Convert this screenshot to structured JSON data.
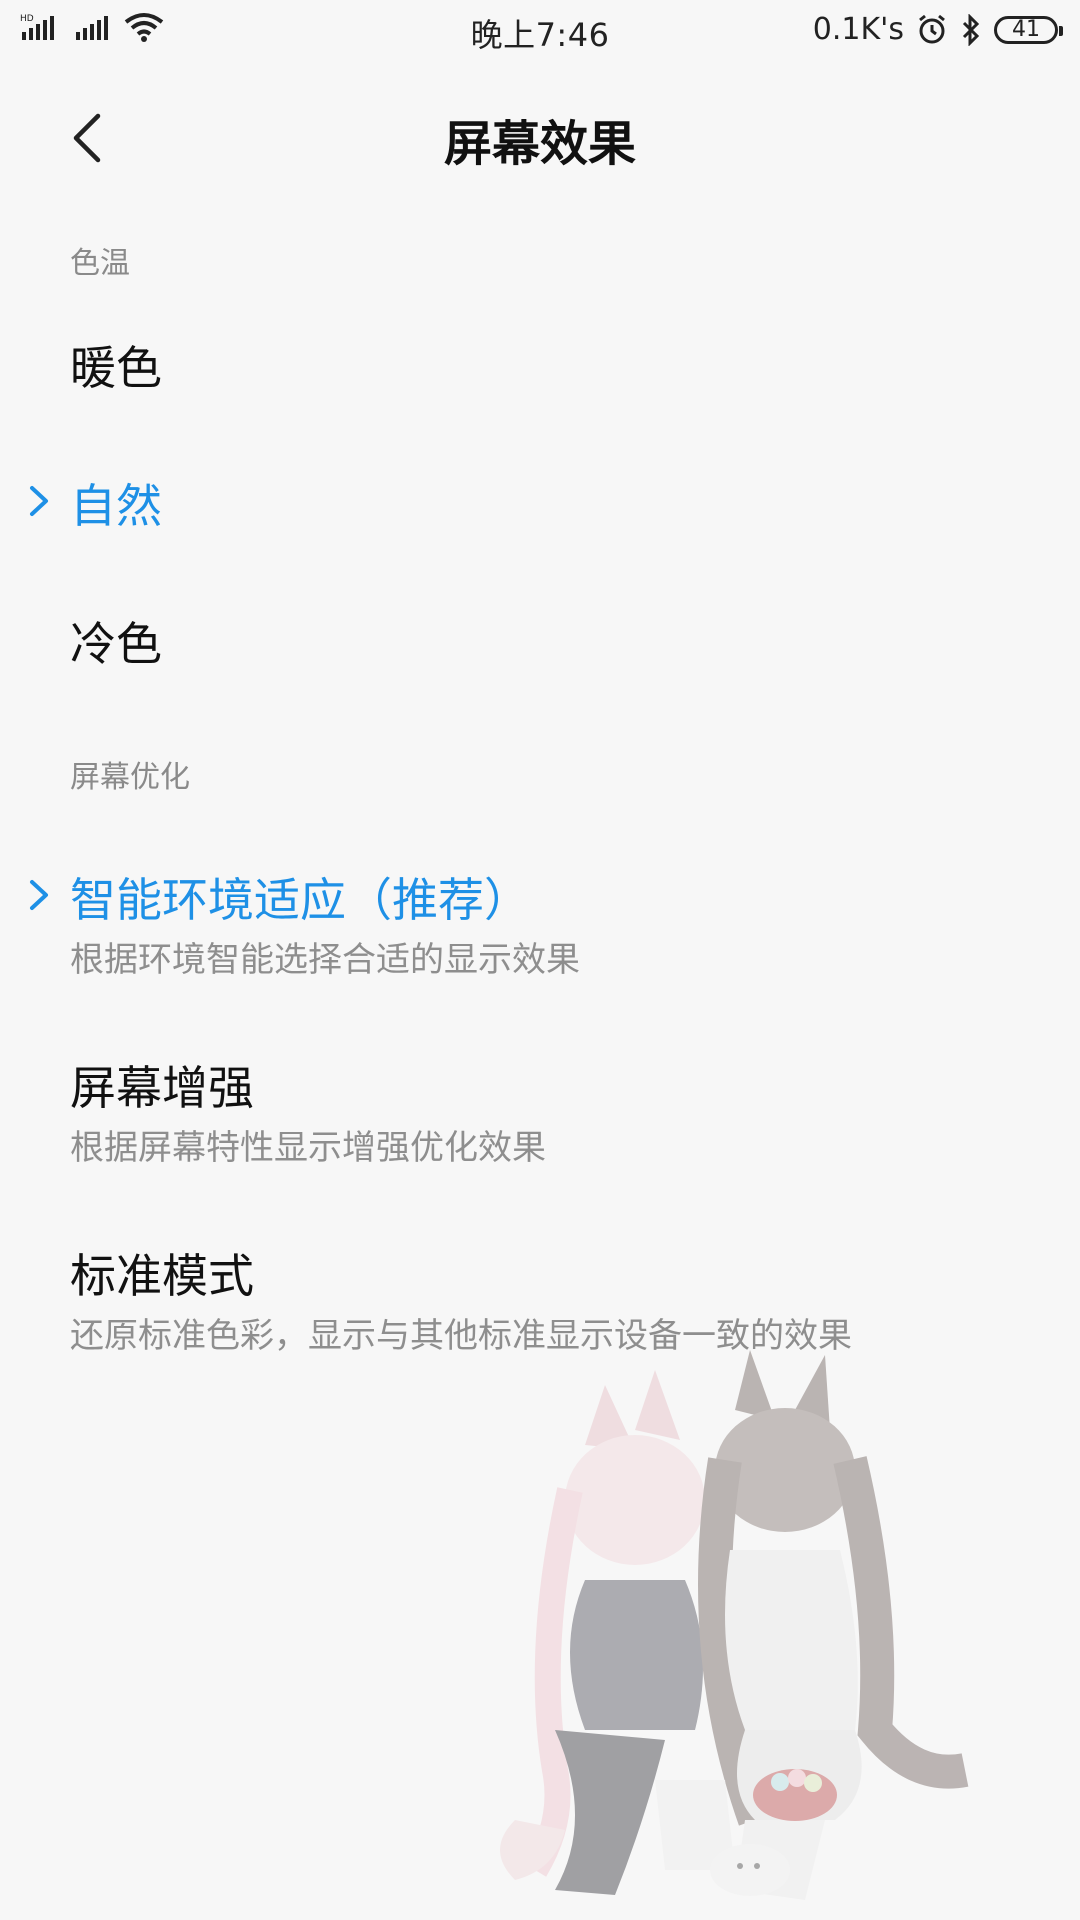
{
  "status_bar": {
    "network_type": "HD",
    "time": "晚上7:46",
    "speed": "0.1K's",
    "battery": "41"
  },
  "header": {
    "title": "屏幕效果"
  },
  "color_temperature": {
    "section_title": "色温",
    "options": [
      {
        "label": "暖色",
        "selected": false
      },
      {
        "label": "自然",
        "selected": true
      },
      {
        "label": "冷色",
        "selected": false
      }
    ]
  },
  "screen_optimization": {
    "section_title": "屏幕优化",
    "options": [
      {
        "label": "智能环境适应（推荐）",
        "description": "根据环境智能选择合适的显示效果",
        "selected": true
      },
      {
        "label": "屏幕增强",
        "description": "根据屏幕特性显示增强优化效果",
        "selected": false
      },
      {
        "label": "标准模式",
        "description": "还原标准色彩，显示与其他标准显示设备一致的效果",
        "selected": false
      }
    ]
  },
  "colors": {
    "accent": "#1e90e6",
    "secondary_text": "#8e8e8e"
  }
}
